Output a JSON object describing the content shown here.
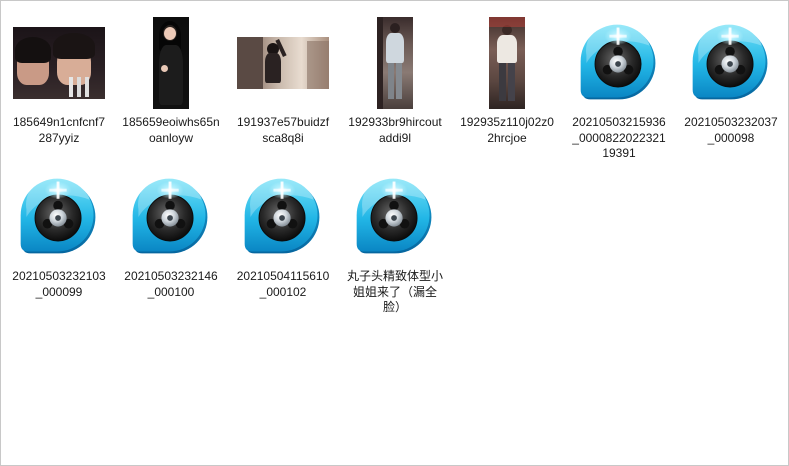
{
  "files": [
    {
      "label": "185649n1cnfcnf7287yyiz",
      "icon": "photo-thumbnail"
    },
    {
      "label": "185659eoiwhs65noanloyw",
      "icon": "photo-thumbnail"
    },
    {
      "label": "191937e57buidzfsca8q8i",
      "icon": "photo-thumbnail"
    },
    {
      "label": "192933br9hircoutaddi9l",
      "icon": "photo-thumbnail"
    },
    {
      "label": "192935z110j02z02hrcjoe",
      "icon": "photo-thumbnail"
    },
    {
      "label": "20210503215936_000082202232119391",
      "icon": "video-reel-icon"
    },
    {
      "label": "20210503232037_000098",
      "icon": "video-reel-icon"
    },
    {
      "label": "20210503232103_000099",
      "icon": "video-reel-icon"
    },
    {
      "label": "20210503232146_000100",
      "icon": "video-reel-icon"
    },
    {
      "label": "20210504115610_000102",
      "icon": "video-reel-icon"
    },
    {
      "label": "丸子头精致体型小姐姐来了（漏全脸）",
      "icon": "video-reel-icon"
    }
  ]
}
